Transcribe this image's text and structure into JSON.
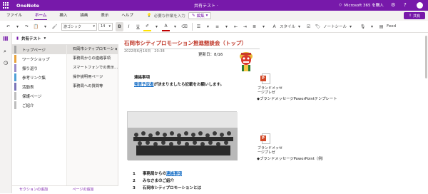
{
  "app": {
    "name": "OneNote",
    "doc_title": "共有テスト ·",
    "ms365": "Microsoft 365 を購入"
  },
  "ribbon": {
    "tabs": [
      "ファイル",
      "ホーム",
      "挿入",
      "描画",
      "表示",
      "ヘルプ"
    ],
    "active_tab": "ホーム",
    "tellme": "必要な作業を入力",
    "edit_label": "編集",
    "share_label": "共有"
  },
  "toolbar": {
    "font": "游ゴシック",
    "size": "14",
    "style_label": "スタイル",
    "tag_label": "ノートシール",
    "feed_label": "Feed"
  },
  "notebook": {
    "name": "共有テスト"
  },
  "sections": [
    {
      "label": "トップページ",
      "color": "#a5a5a5"
    },
    {
      "label": "ワークショップ",
      "color": "#e8a33d"
    },
    {
      "label": "振り返り",
      "color": "#9a8cc9"
    },
    {
      "label": "参考リンク集",
      "color": "#4f9fd6"
    },
    {
      "label": "活動表",
      "color": "#7a74b8"
    },
    {
      "label": "保護ページ",
      "color": "#bdbdbd"
    },
    {
      "label": "ご紹介",
      "color": "#bdbdbd"
    }
  ],
  "pages": [
    "石岡市シティプロモーショ",
    "事務局からの連絡事項",
    "スマートフォンでの表示...",
    "操作説明用ページ",
    "事務局への質問等"
  ],
  "bottom": {
    "add_section": "セクションの追加",
    "add_page": "ページの追加"
  },
  "page": {
    "title": "石岡市シティプロモーション推進懇談会（トップ）",
    "date": "2022年6月16日　20:38",
    "updated": "更新日：8/16",
    "notice_heading": "連絡事項",
    "notice_link": "発表予定者",
    "notice_text": "が決まりましたら記載をお願いします。",
    "attach1_name": "ブランドメッセージプレゼ",
    "attach1_desc": "◆ブランドメッセージPowerPointテンプレート",
    "attach2_name": "ブランドメッセージプレゼ",
    "attach2_desc": "◆ブランドメッセージPowerPoint（例）",
    "list": [
      {
        "num": "1",
        "text": "事務局からの",
        "link": "連絡事項"
      },
      {
        "num": "2",
        "text": "みなさまのご紹介",
        "link": ""
      },
      {
        "num": "3",
        "text": "石岡市シティプロモーションとは",
        "link": ""
      }
    ]
  },
  "colors": {
    "accent": "#7719aa",
    "title_red": "#c0392b",
    "link": "#0563c1",
    "powerpoint": "#d24726"
  },
  "icons": [
    "waffle-icon",
    "lightbulb-icon",
    "pencil-icon",
    "share-icon",
    "undo-icon",
    "redo-icon",
    "clipboard-icon",
    "bold-icon",
    "italic-icon",
    "underline-icon",
    "highlight-icon",
    "font-color-icon",
    "eraser-icon",
    "bullets-icon",
    "numbering-icon",
    "indent-icon",
    "align-icon",
    "checkbox-icon",
    "tag-icon",
    "dictate-icon",
    "feed-icon",
    "notebooks-icon",
    "search-icon",
    "recent-icon",
    "chevron-down-icon",
    "powerpoint-icon",
    "settings-icon",
    "help-icon"
  ]
}
